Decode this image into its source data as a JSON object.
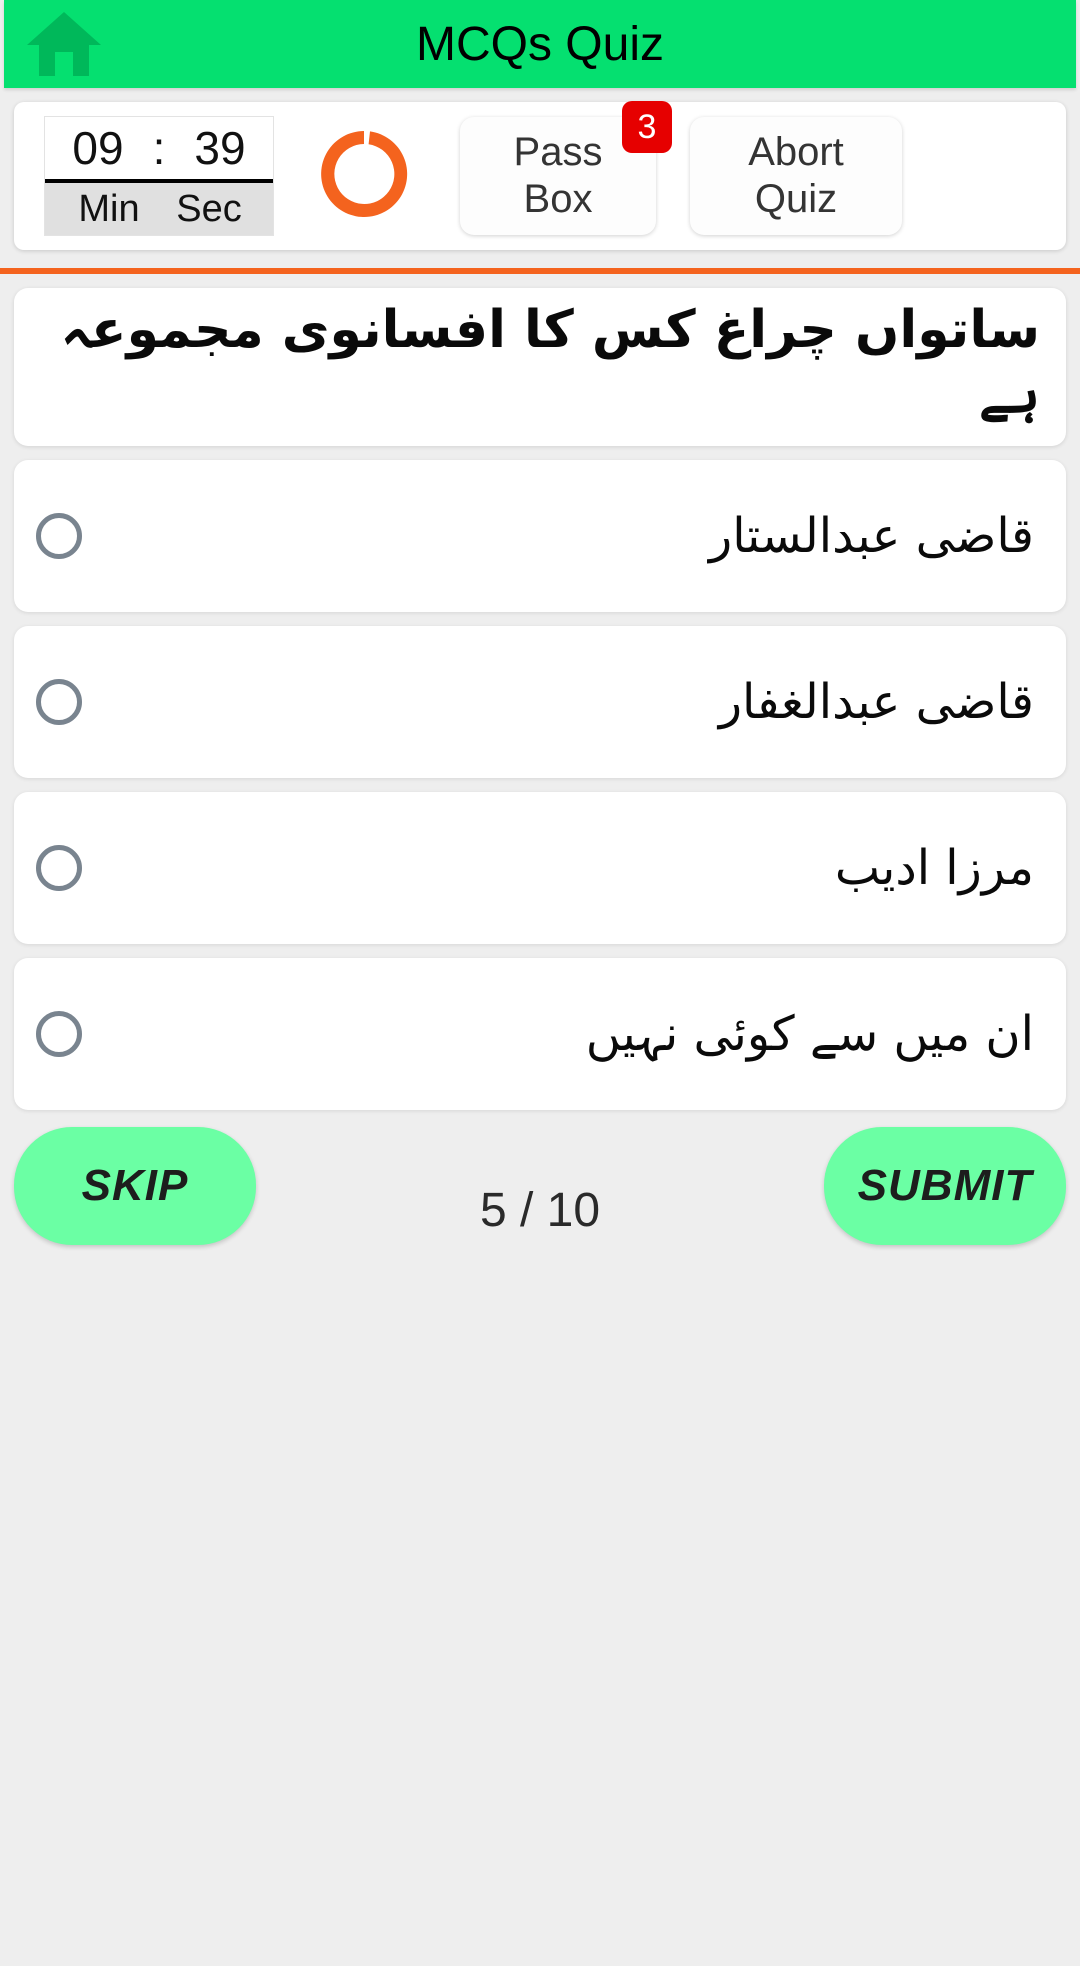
{
  "appbar": {
    "title": "MCQs Quiz",
    "home_icon": "home-icon",
    "background_color": "#05e070"
  },
  "status_bar": {
    "timer": {
      "minutes": "09",
      "separator": ":",
      "seconds": "39",
      "minutes_label": "Min",
      "seconds_label": "Sec"
    },
    "spinner": {
      "icon": "loading-ring-icon",
      "color": "#f4631e"
    },
    "pass_box": {
      "line1": "Pass",
      "line2": "Box",
      "badge_count": "3",
      "badge_color": "#e60000"
    },
    "abort_quiz": {
      "line1": "Abort",
      "line2": "Quiz"
    },
    "divider_color": "#f4631e"
  },
  "question": {
    "text": "ساتواں چراغ کس کا افسانوی مجموعہ ہے"
  },
  "options": [
    {
      "label": "قاضی عبدالستار",
      "selected": false
    },
    {
      "label": "قاضی عبدالغفار",
      "selected": false
    },
    {
      "label": "مرزا ادیب",
      "selected": false
    },
    {
      "label": "ان میں سے کوئی نہیں",
      "selected": false
    }
  ],
  "footer": {
    "skip_label": "SKIP",
    "submit_label": "SUBMIT",
    "counter": "5 / 10",
    "button_color": "#6bffa4"
  }
}
